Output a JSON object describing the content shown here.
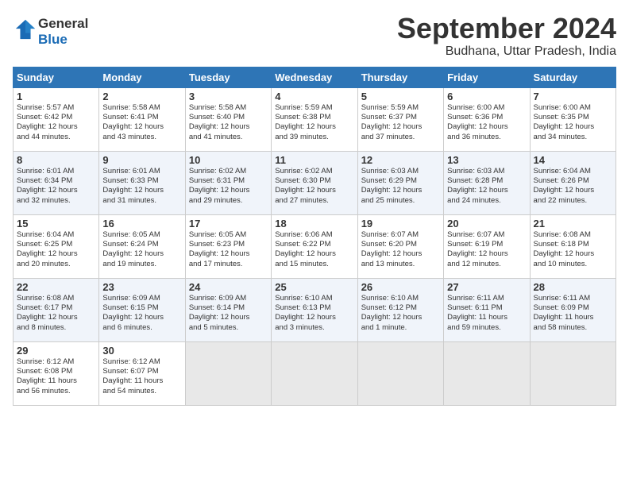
{
  "header": {
    "logo_line1": "General",
    "logo_line2": "Blue",
    "title": "September 2024",
    "subtitle": "Budhana, Uttar Pradesh, India"
  },
  "weekdays": [
    "Sunday",
    "Monday",
    "Tuesday",
    "Wednesday",
    "Thursday",
    "Friday",
    "Saturday"
  ],
  "weeks": [
    [
      {
        "day": "1",
        "info": "Sunrise: 5:57 AM\nSunset: 6:42 PM\nDaylight: 12 hours\nand 44 minutes."
      },
      {
        "day": "2",
        "info": "Sunrise: 5:58 AM\nSunset: 6:41 PM\nDaylight: 12 hours\nand 43 minutes."
      },
      {
        "day": "3",
        "info": "Sunrise: 5:58 AM\nSunset: 6:40 PM\nDaylight: 12 hours\nand 41 minutes."
      },
      {
        "day": "4",
        "info": "Sunrise: 5:59 AM\nSunset: 6:38 PM\nDaylight: 12 hours\nand 39 minutes."
      },
      {
        "day": "5",
        "info": "Sunrise: 5:59 AM\nSunset: 6:37 PM\nDaylight: 12 hours\nand 37 minutes."
      },
      {
        "day": "6",
        "info": "Sunrise: 6:00 AM\nSunset: 6:36 PM\nDaylight: 12 hours\nand 36 minutes."
      },
      {
        "day": "7",
        "info": "Sunrise: 6:00 AM\nSunset: 6:35 PM\nDaylight: 12 hours\nand 34 minutes."
      }
    ],
    [
      {
        "day": "8",
        "info": "Sunrise: 6:01 AM\nSunset: 6:34 PM\nDaylight: 12 hours\nand 32 minutes."
      },
      {
        "day": "9",
        "info": "Sunrise: 6:01 AM\nSunset: 6:33 PM\nDaylight: 12 hours\nand 31 minutes."
      },
      {
        "day": "10",
        "info": "Sunrise: 6:02 AM\nSunset: 6:31 PM\nDaylight: 12 hours\nand 29 minutes."
      },
      {
        "day": "11",
        "info": "Sunrise: 6:02 AM\nSunset: 6:30 PM\nDaylight: 12 hours\nand 27 minutes."
      },
      {
        "day": "12",
        "info": "Sunrise: 6:03 AM\nSunset: 6:29 PM\nDaylight: 12 hours\nand 25 minutes."
      },
      {
        "day": "13",
        "info": "Sunrise: 6:03 AM\nSunset: 6:28 PM\nDaylight: 12 hours\nand 24 minutes."
      },
      {
        "day": "14",
        "info": "Sunrise: 6:04 AM\nSunset: 6:26 PM\nDaylight: 12 hours\nand 22 minutes."
      }
    ],
    [
      {
        "day": "15",
        "info": "Sunrise: 6:04 AM\nSunset: 6:25 PM\nDaylight: 12 hours\nand 20 minutes."
      },
      {
        "day": "16",
        "info": "Sunrise: 6:05 AM\nSunset: 6:24 PM\nDaylight: 12 hours\nand 19 minutes."
      },
      {
        "day": "17",
        "info": "Sunrise: 6:05 AM\nSunset: 6:23 PM\nDaylight: 12 hours\nand 17 minutes."
      },
      {
        "day": "18",
        "info": "Sunrise: 6:06 AM\nSunset: 6:22 PM\nDaylight: 12 hours\nand 15 minutes."
      },
      {
        "day": "19",
        "info": "Sunrise: 6:07 AM\nSunset: 6:20 PM\nDaylight: 12 hours\nand 13 minutes."
      },
      {
        "day": "20",
        "info": "Sunrise: 6:07 AM\nSunset: 6:19 PM\nDaylight: 12 hours\nand 12 minutes."
      },
      {
        "day": "21",
        "info": "Sunrise: 6:08 AM\nSunset: 6:18 PM\nDaylight: 12 hours\nand 10 minutes."
      }
    ],
    [
      {
        "day": "22",
        "info": "Sunrise: 6:08 AM\nSunset: 6:17 PM\nDaylight: 12 hours\nand 8 minutes."
      },
      {
        "day": "23",
        "info": "Sunrise: 6:09 AM\nSunset: 6:15 PM\nDaylight: 12 hours\nand 6 minutes."
      },
      {
        "day": "24",
        "info": "Sunrise: 6:09 AM\nSunset: 6:14 PM\nDaylight: 12 hours\nand 5 minutes."
      },
      {
        "day": "25",
        "info": "Sunrise: 6:10 AM\nSunset: 6:13 PM\nDaylight: 12 hours\nand 3 minutes."
      },
      {
        "day": "26",
        "info": "Sunrise: 6:10 AM\nSunset: 6:12 PM\nDaylight: 12 hours\nand 1 minute."
      },
      {
        "day": "27",
        "info": "Sunrise: 6:11 AM\nSunset: 6:11 PM\nDaylight: 11 hours\nand 59 minutes."
      },
      {
        "day": "28",
        "info": "Sunrise: 6:11 AM\nSunset: 6:09 PM\nDaylight: 11 hours\nand 58 minutes."
      }
    ],
    [
      {
        "day": "29",
        "info": "Sunrise: 6:12 AM\nSunset: 6:08 PM\nDaylight: 11 hours\nand 56 minutes."
      },
      {
        "day": "30",
        "info": "Sunrise: 6:12 AM\nSunset: 6:07 PM\nDaylight: 11 hours\nand 54 minutes."
      },
      null,
      null,
      null,
      null,
      null
    ]
  ]
}
